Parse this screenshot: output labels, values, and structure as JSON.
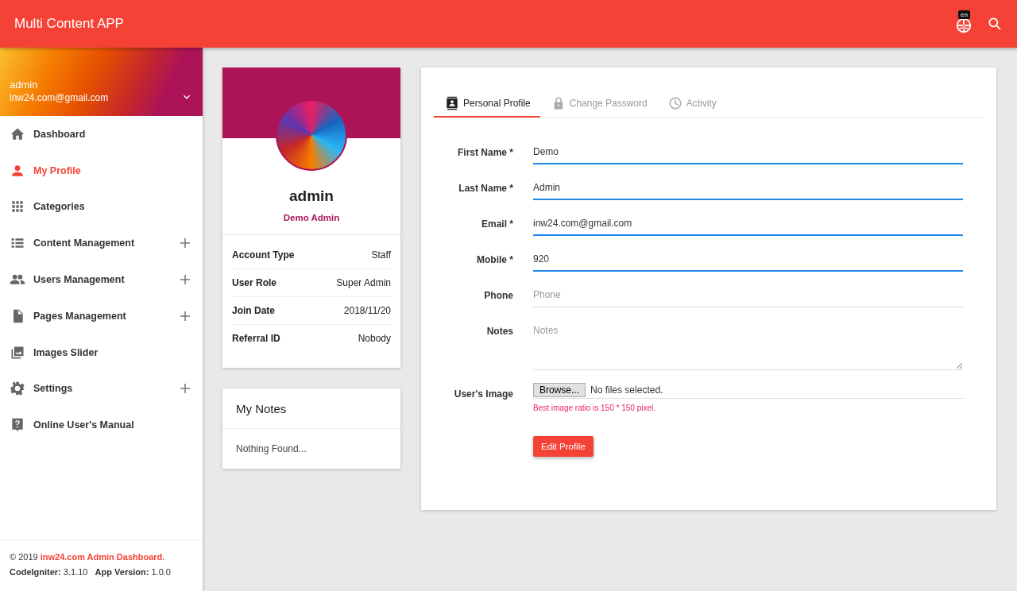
{
  "app_bar": {
    "title": "Multi Content APP",
    "language_badge": "en"
  },
  "sidebar": {
    "user": {
      "name": "admin",
      "email": "inw24.com@gmail.com"
    },
    "items": [
      {
        "label": "Dashboard",
        "selected": false,
        "expandable": false
      },
      {
        "label": "My Profile",
        "selected": true,
        "expandable": false
      },
      {
        "label": "Categories",
        "selected": false,
        "expandable": false
      },
      {
        "label": "Content Management",
        "selected": false,
        "expandable": true
      },
      {
        "label": "Users Management",
        "selected": false,
        "expandable": true
      },
      {
        "label": "Pages Management",
        "selected": false,
        "expandable": true
      },
      {
        "label": "Images Slider",
        "selected": false,
        "expandable": false
      },
      {
        "label": "Settings",
        "selected": false,
        "expandable": true
      },
      {
        "label": "Online User's Manual",
        "selected": false,
        "expandable": false
      }
    ],
    "footer": {
      "copyright": "© 2019 ",
      "link": "inw24.com Admin Dashboard",
      "after_link": ".",
      "versions": "**CodeIgniter:** 3.1.10   **App Version:** 1.0.0"
    }
  },
  "profile_card": {
    "name": "admin",
    "role": "Demo Admin",
    "details": [
      {
        "label": "Account Type",
        "value": "Staff"
      },
      {
        "label": "User Role",
        "value": "Super Admin"
      },
      {
        "label": "Join Date",
        "value": "2018/11/20"
      },
      {
        "label": "Referral ID",
        "value": "Nobody"
      }
    ]
  },
  "notes_card": {
    "title": "My Notes",
    "empty_text": "Nothing Found..."
  },
  "form": {
    "tabs": [
      {
        "label": "Personal Profile",
        "selected": true
      },
      {
        "label": "Change Password",
        "selected": false
      },
      {
        "label": "Activity",
        "selected": false
      }
    ],
    "fields": [
      {
        "kind": "text",
        "label": "First Name *",
        "value": "Demo"
      },
      {
        "kind": "text",
        "label": "Last Name *",
        "value": "Admin"
      },
      {
        "kind": "text",
        "label": "Email *",
        "value": "inw24.com@gmail.com"
      },
      {
        "kind": "text",
        "label": "Mobile *",
        "value": "920"
      },
      {
        "kind": "text",
        "label": "Phone",
        "placeholder": "Phone"
      },
      {
        "kind": "textarea",
        "label": "Notes",
        "placeholder": "Notes"
      }
    ],
    "image_upload": {
      "label": "User's Image",
      "button": "Browse...",
      "status": "No files selected.",
      "hint": "Best image ratio is 150 * 150 pixel."
    },
    "submit": "Edit Profile"
  }
}
